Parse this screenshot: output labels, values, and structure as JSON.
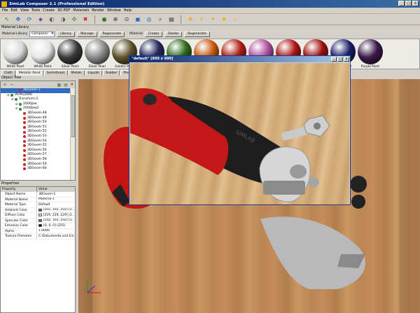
{
  "app": {
    "title": "SimLab Composer 2.1 (Professional Edition)"
  },
  "window_buttons": [
    "_",
    "□",
    "×"
  ],
  "menu": [
    "File",
    "Edit",
    "View",
    "Tools",
    "Create",
    "3D PDF",
    "Materials",
    "Render",
    "Window",
    "Help"
  ],
  "toolbar_icons": [
    "select-icon",
    "move-icon",
    "rotate-icon",
    "scale-icon",
    "hide-icon",
    "show-icon",
    "pan-icon",
    "delete-icon",
    "material-icon",
    "fit-icon",
    "zoom-icon",
    "zoom-box-icon",
    "orbit-icon",
    "look-icon",
    "render-icon",
    "bulb-icon",
    "light-icon",
    "camera-icon",
    "sun-icon",
    "spot-icon"
  ],
  "material_library": {
    "panel_title": "Material Library",
    "library_label": "Material Library",
    "library_select": "Composer",
    "buttons_left": [
      "Library",
      "Manage",
      "Regenerate"
    ],
    "buttons_right_label": "Material",
    "buttons_right": [
      "Create",
      "Delete",
      "Regenerate"
    ],
    "swatches": [
      {
        "label": "White Pearl",
        "color": "#d9d9d9"
      },
      {
        "label": "White Paint",
        "color": "#e6e6e6"
      },
      {
        "label": "Silver Paint",
        "color": "#3a3a3a"
      },
      {
        "label": "Silver Pearl",
        "color": "#8a8a8a"
      },
      {
        "label": "Golden Pearl",
        "color": "#5d532b"
      },
      {
        "label": "",
        "color": "#24295a"
      },
      {
        "label": "",
        "color": "#2f6b1a"
      },
      {
        "label": "",
        "color": "#c85a10"
      },
      {
        "label": "",
        "color": "#b01f14"
      },
      {
        "label": "",
        "color": "#b04fa0"
      },
      {
        "label": "",
        "color": "#b01414"
      },
      {
        "label": "",
        "color": "#a01010"
      },
      {
        "label": "Violet Pearl",
        "color": "#1d1f6a"
      },
      {
        "label": "Purple Paint",
        "color": "#3c1a4a"
      }
    ],
    "categories": [
      "Cloth",
      "Metallic Paint",
      "Gemstones",
      "Metals",
      "Liquids",
      "Rubber",
      "Plastic",
      "Tra"
    ]
  },
  "object_tree": {
    "panel_title": "Object Tree",
    "rows": [
      {
        "label": "3DGeom-1",
        "depth": 3,
        "icon": "geom"
      },
      {
        "label": "Verfix2000",
        "depth": 1,
        "icon": "group"
      },
      {
        "label": "Transform-1",
        "depth": 2,
        "icon": "group"
      },
      {
        "label": "2000Jaw",
        "depth": 3,
        "icon": "group"
      },
      {
        "label": "2000Jaw2",
        "depth": 3,
        "icon": "group"
      },
      {
        "label": "3DGeom-48",
        "depth": 4,
        "icon": "geom"
      },
      {
        "label": "3DGeom-49",
        "depth": 4,
        "icon": "geom"
      },
      {
        "label": "3DGeom-50",
        "depth": 4,
        "icon": "geom"
      },
      {
        "label": "3DGeom-51",
        "depth": 4,
        "icon": "geom"
      },
      {
        "label": "3DGeom-52",
        "depth": 4,
        "icon": "geom"
      },
      {
        "label": "3DGeom-53",
        "depth": 4,
        "icon": "geom"
      },
      {
        "label": "3DGeom-54",
        "depth": 4,
        "icon": "geom"
      },
      {
        "label": "3DGeom-55",
        "depth": 4,
        "icon": "geom"
      },
      {
        "label": "3DGeom-56",
        "depth": 4,
        "icon": "geom"
      },
      {
        "label": "3DGeom-57",
        "depth": 4,
        "icon": "geom"
      },
      {
        "label": "3DGeom-58",
        "depth": 4,
        "icon": "geom"
      },
      {
        "label": "3DGeom-59",
        "depth": 4,
        "icon": "geom"
      },
      {
        "label": "3DGeom-60",
        "depth": 4,
        "icon": "geom"
      }
    ]
  },
  "properties": {
    "panel_title": "Properties",
    "header": {
      "property": "Property",
      "value": "Value"
    },
    "rows": [
      {
        "key": "Object Name",
        "value": "3DGeom-1"
      },
      {
        "key": "Material Name",
        "value": "Material-1"
      },
      {
        "key": "Material Type",
        "value": "Default"
      },
      {
        "key": "Ambient Color",
        "value": "[102, 102, 102] (2...",
        "swatch": "#666666"
      },
      {
        "key": "Diffuse Color",
        "value": "[229, 229, 229] (2...",
        "swatch": "#e5e5e5"
      },
      {
        "key": "Specular Color",
        "value": "[102, 102, 102] (2...",
        "swatch": "#666666"
      },
      {
        "key": "Emission Color",
        "value": "[0, 0, 0] (255)",
        "swatch": "#000000"
      },
      {
        "key": "Alpha",
        "value": "1.0000"
      },
      {
        "key": "Texture Filename",
        "value": "C:\\Dokumente und Ein..."
      }
    ]
  },
  "render_window": {
    "title": "\"default\" [800 x 600]",
    "buttons": [
      "_",
      "□",
      "×"
    ],
    "wrench_text": "SIMLAB"
  }
}
